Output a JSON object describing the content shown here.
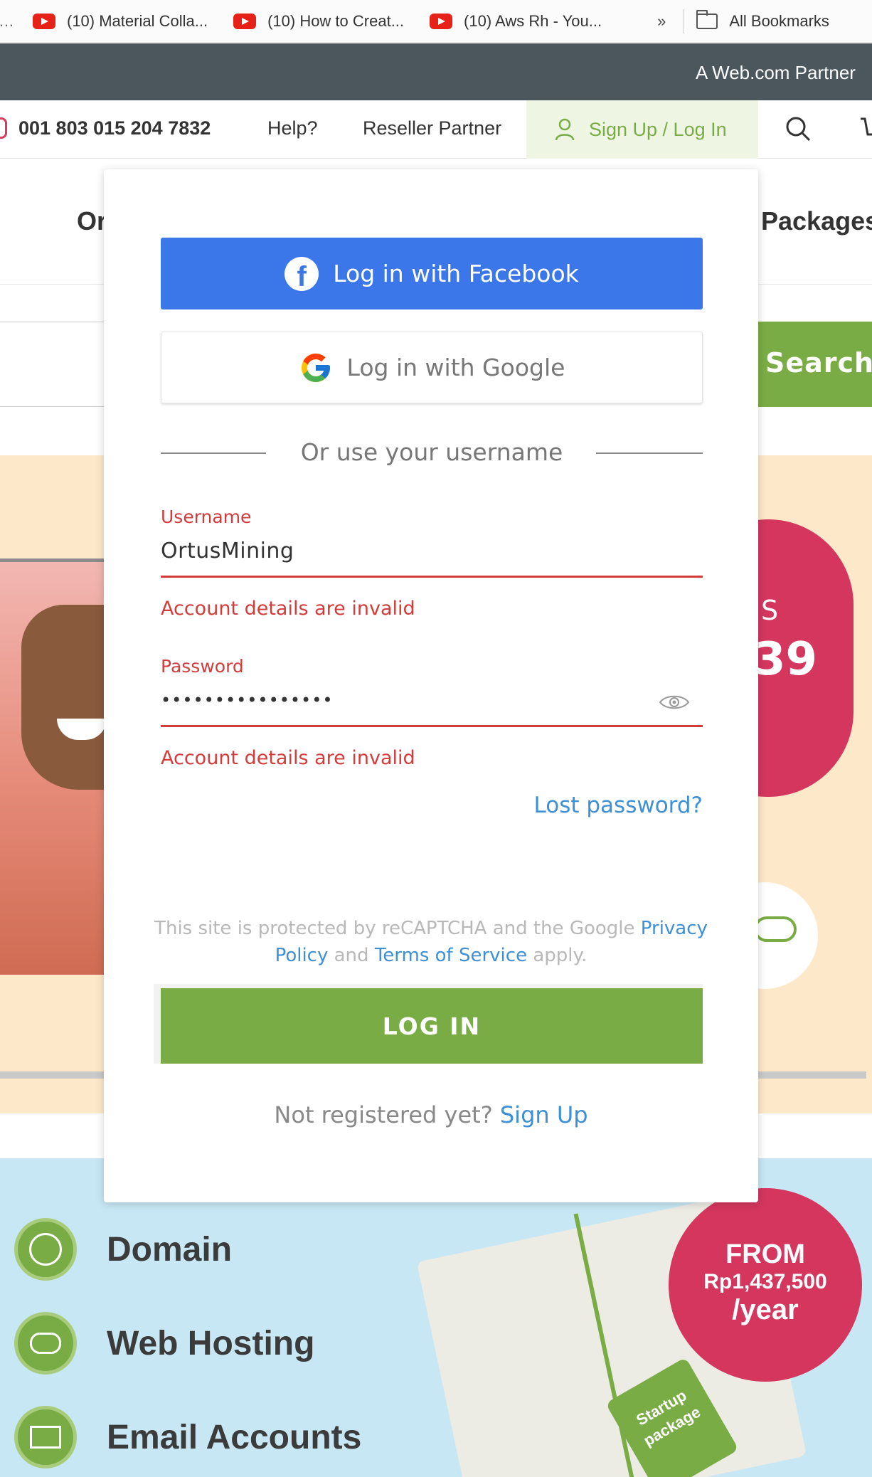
{
  "bookmarks": {
    "items": [
      {
        "label": "(10) Material Colla..."
      },
      {
        "label": "(10) How to Creat..."
      },
      {
        "label": "(10) Aws Rh - You..."
      }
    ],
    "more": "»",
    "folder": "All Bookmarks"
  },
  "partner_bar": {
    "text": "A Web.com Partner"
  },
  "topnav": {
    "phone": "001 803 015 204 7832",
    "help": "Help?",
    "reseller": "Reseller Partner",
    "signup": "Sign Up / Log In"
  },
  "background": {
    "menu_left": "Or",
    "menu_right": "Packages",
    "search_button": "Search",
    "badge_s": "S",
    "badge_n": "39",
    "services": [
      {
        "label": "Domain",
        "icon": "globe-www-icon"
      },
      {
        "label": "Web Hosting",
        "icon": "cloud-icon"
      },
      {
        "label": "Email Accounts",
        "icon": "envelope-icon"
      }
    ],
    "package_tag": "Startup package",
    "from": {
      "line1": "FROM",
      "price": "Rp1,437,500",
      "period": "/year"
    }
  },
  "modal": {
    "facebook": "Log in with Facebook",
    "google": "Log in with Google",
    "divider": "Or use your username",
    "username_label": "Username",
    "username_value": "OrtusMining",
    "username_error": "Account details are invalid",
    "password_label": "Password",
    "password_value": "••••••••••••••••",
    "password_error": "Account details are invalid",
    "lost_password": "Lost password?",
    "recaptcha": {
      "prefix": "This site is protected by reCAPTCHA and the Google",
      "privacy": "Privacy Policy",
      "and": "and",
      "terms": "Terms of Service",
      "suffix": "apply."
    },
    "login_button": "LOG IN",
    "register_prompt": "Not registered yet?",
    "register_link": "Sign Up"
  },
  "colors": {
    "green": "#7aac45",
    "facebook_blue": "#3b77e8",
    "error_red": "#d43b3b",
    "link_blue": "#3d8fd6",
    "badge_pink": "#d4365e"
  }
}
